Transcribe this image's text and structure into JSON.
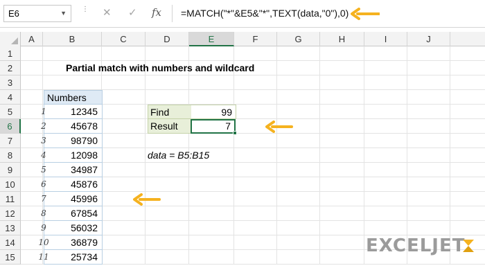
{
  "formula_bar": {
    "name_box": "E6",
    "cancel_icon": "✕",
    "enter_icon": "✓",
    "fx_label": "fx",
    "formula": "=MATCH(\"*\"&E5&\"*\",TEXT(data,\"0\"),0)"
  },
  "columns": [
    "A",
    "B",
    "C",
    "D",
    "E",
    "F",
    "G",
    "H",
    "I",
    "J"
  ],
  "rows": [
    "1",
    "2",
    "3",
    "4",
    "5",
    "6",
    "7",
    "8",
    "9",
    "10",
    "11",
    "12",
    "13",
    "14",
    "15"
  ],
  "active_cell": {
    "column": "E",
    "row": "6"
  },
  "sheet": {
    "title": "Partial match with numbers and wildcard",
    "numbers_header": "Numbers",
    "numbers": [
      "12345",
      "45678",
      "98790",
      "12098",
      "34987",
      "45876",
      "45996",
      "67854",
      "56032",
      "36879",
      "25734"
    ],
    "indexes": [
      "1",
      "2",
      "3",
      "4",
      "5",
      "6",
      "7",
      "8",
      "9",
      "10",
      "11"
    ],
    "find_label": "Find",
    "find_value": "99",
    "result_label": "Result",
    "result_value": "7",
    "named_range_note": "data = B5:B15"
  },
  "logo": {
    "text": "EXCELJET"
  },
  "colors": {
    "arrow": "#f5b21f",
    "excel_green": "#217346",
    "header_fill": "#dfeaf5",
    "label_fill": "#e8efd9"
  }
}
